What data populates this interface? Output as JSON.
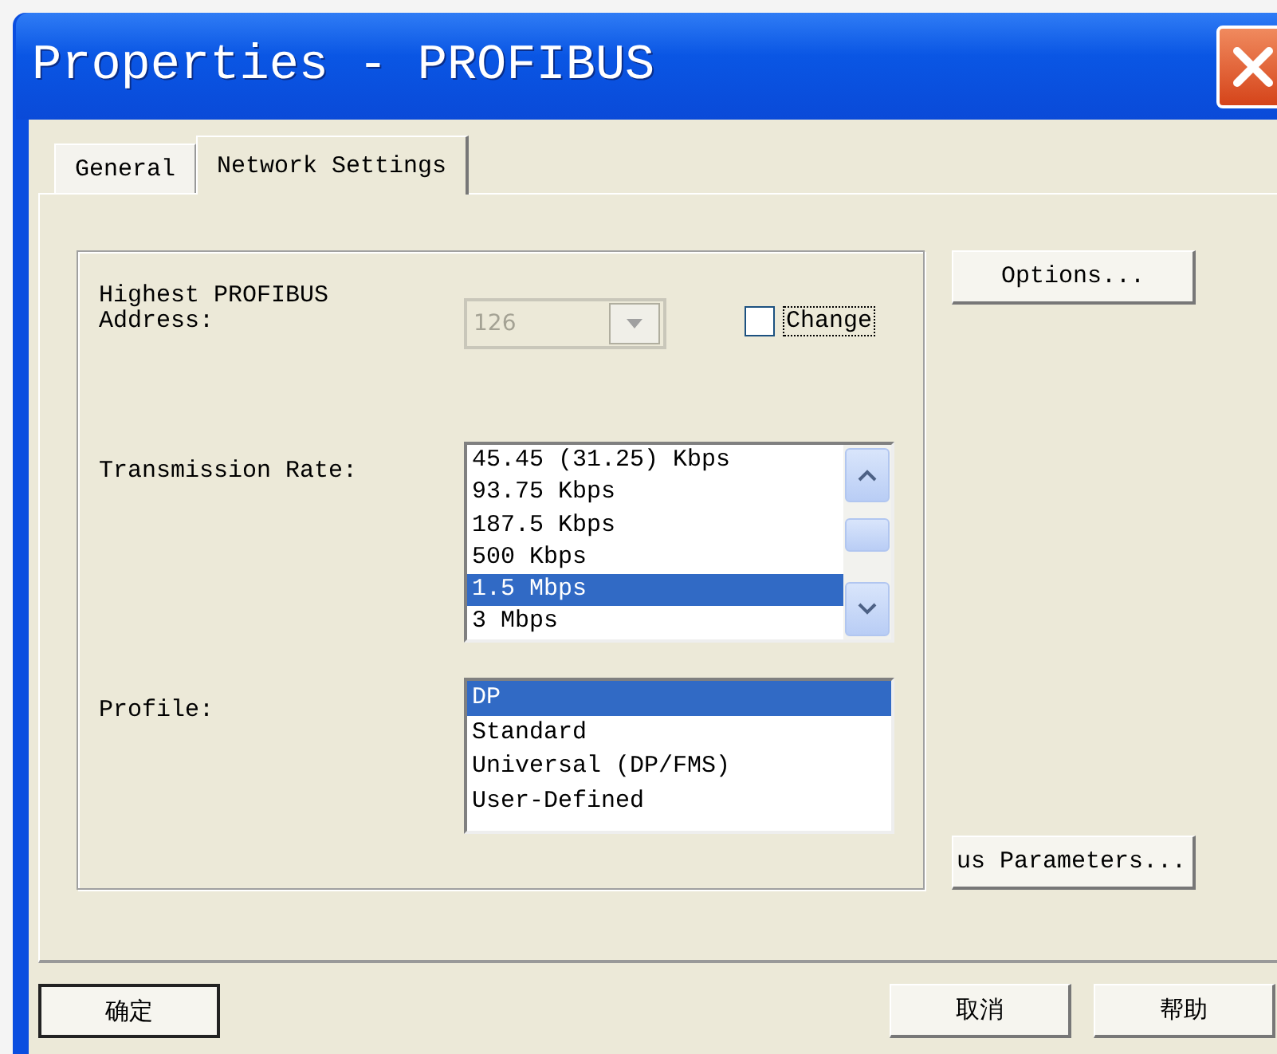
{
  "window": {
    "title": "Properties - PROFIBUS"
  },
  "tabs": [
    {
      "label": "General",
      "selected": false
    },
    {
      "label": "Network Settings",
      "selected": true
    }
  ],
  "highest_address": {
    "label": "Highest PROFIBUS Address:",
    "value": "126",
    "disabled": true
  },
  "change": {
    "label": "Change",
    "checked": false
  },
  "transmission_rate": {
    "label": "Transmission Rate:",
    "items": [
      {
        "label": "45.45 (31.25) Kbps",
        "selected": false
      },
      {
        "label": "93.75 Kbps",
        "selected": false
      },
      {
        "label": "187.5 Kbps",
        "selected": false
      },
      {
        "label": "500 Kbps",
        "selected": false
      },
      {
        "label": "1.5 Mbps",
        "selected": true
      },
      {
        "label": "3 Mbps",
        "selected": false
      }
    ]
  },
  "profile": {
    "label": "Profile:",
    "items": [
      {
        "label": "DP",
        "selected": true
      },
      {
        "label": "Standard",
        "selected": false
      },
      {
        "label": "Universal (DP/FMS)",
        "selected": false
      },
      {
        "label": "User-Defined",
        "selected": false
      }
    ]
  },
  "side_buttons": {
    "options": "Options...",
    "bus_parameters": "us Parameters..."
  },
  "footer_buttons": [
    {
      "label": "确定",
      "default": true
    },
    {
      "label": "取消",
      "default": false
    },
    {
      "label": "帮助",
      "default": false
    }
  ]
}
